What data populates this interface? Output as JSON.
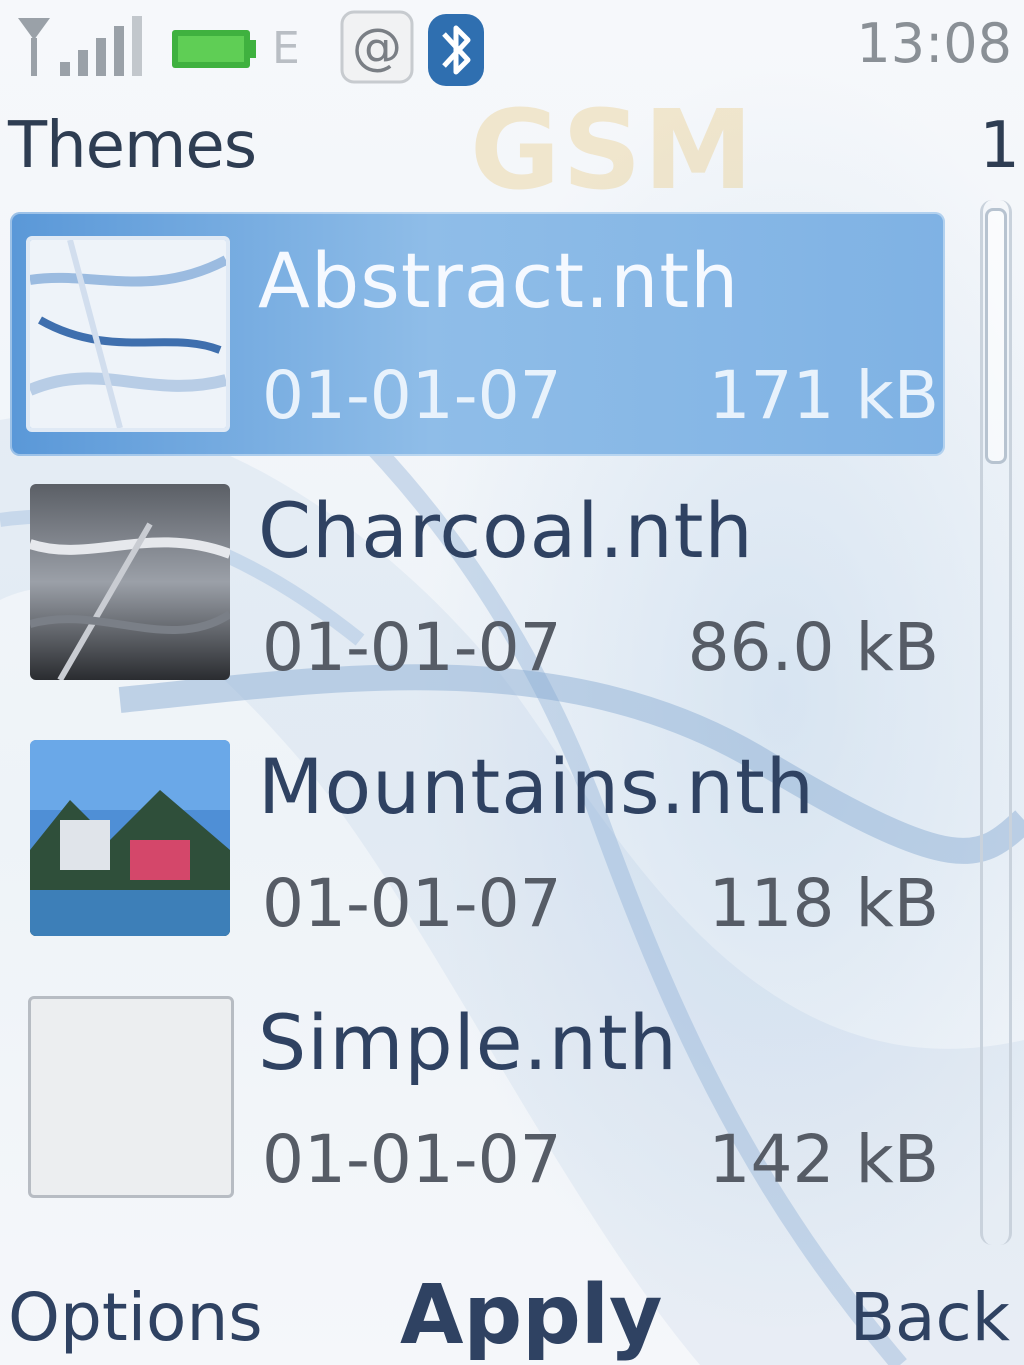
{
  "status_bar": {
    "network_type": "E",
    "time": "13:08",
    "icons": [
      "signal-icon",
      "battery-icon",
      "edge-icon",
      "email-icon",
      "bluetooth-icon"
    ]
  },
  "header": {
    "title": "Themes",
    "page_index": "1",
    "watermark": "GSM"
  },
  "themes": [
    {
      "name": "Abstract.nth",
      "date": "01-01-07",
      "size": "171 kB",
      "selected": true,
      "thumbnail": "abstract-thumbnail"
    },
    {
      "name": "Charcoal.nth",
      "date": "01-01-07",
      "size": "86.0 kB",
      "selected": false,
      "thumbnail": "charcoal-thumbnail"
    },
    {
      "name": "Mountains.nth",
      "date": "01-01-07",
      "size": "118 kB",
      "selected": false,
      "thumbnail": "mountains-thumbnail"
    },
    {
      "name": "Simple.nth",
      "date": "01-01-07",
      "size": "142 kB",
      "selected": false,
      "thumbnail": "simple-thumbnail"
    }
  ],
  "softkeys": {
    "left": "Options",
    "center": "Apply",
    "right": "Back"
  },
  "colors": {
    "highlight": "#6fa8e0",
    "text_primary": "#2f4262",
    "text_secondary": "#565c66",
    "battery": "#3fb13f",
    "bluetooth": "#2f6fb0"
  }
}
